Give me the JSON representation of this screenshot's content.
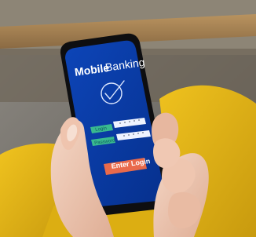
{
  "app": {
    "title_bold": "Mobile",
    "title_regular": "Banking"
  },
  "form": {
    "login_label": "Login",
    "password_label": "Password",
    "submit_label": "Enter Login"
  },
  "colors": {
    "screen": "#0b3aa8",
    "field_label": "#39b98f",
    "button": "#e96a4b",
    "cushion": "#e8b817"
  },
  "icons": {
    "checkmark": "check-circle-icon"
  }
}
